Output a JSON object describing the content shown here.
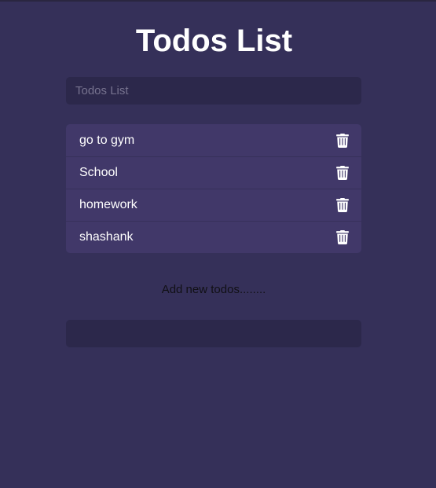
{
  "header": {
    "title": "Todos List"
  },
  "search": {
    "placeholder": "Todos List",
    "value": ""
  },
  "todos": [
    {
      "text": "go to gym",
      "icon": "trash-icon"
    },
    {
      "text": "School",
      "icon": "trash-icon"
    },
    {
      "text": "homework",
      "icon": "trash-icon"
    },
    {
      "text": "shashank",
      "icon": "trash-icon"
    }
  ],
  "add_form": {
    "label": "Add new todos........",
    "value": ""
  },
  "colors": {
    "background": "#353059",
    "input_background": "#2c284b",
    "list_background": "#413869",
    "text": "#ffffff"
  }
}
